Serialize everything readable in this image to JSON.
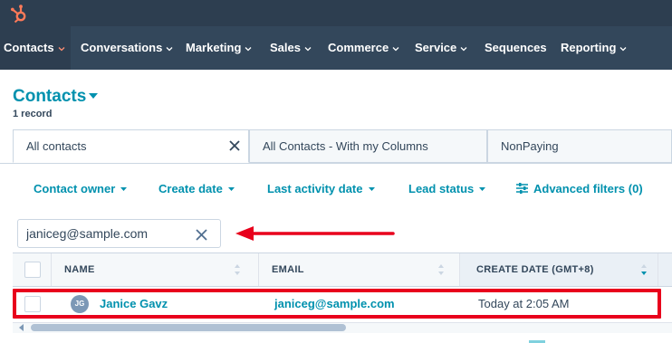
{
  "brand": {
    "logo_icon": "hubspot-sprocket-icon",
    "color": "#ff7a59"
  },
  "nav": {
    "items": [
      {
        "label": "Contacts",
        "has_menu": true,
        "active": true
      },
      {
        "label": "Conversations",
        "has_menu": true
      },
      {
        "label": "Marketing",
        "has_menu": true
      },
      {
        "label": "Sales",
        "has_menu": true
      },
      {
        "label": "Commerce",
        "has_menu": true
      },
      {
        "label": "Service",
        "has_menu": true
      },
      {
        "label": "Sequences",
        "has_menu": false
      },
      {
        "label": "Reporting",
        "has_menu": true
      }
    ]
  },
  "page": {
    "title": "Contacts",
    "record_count": "1 record"
  },
  "tabs": [
    {
      "label": "All contacts",
      "active": true,
      "closable": true
    },
    {
      "label": "All Contacts - With my Columns"
    },
    {
      "label": "NonPaying"
    }
  ],
  "filters": {
    "contact_owner": "Contact owner",
    "create_date": "Create date",
    "last_activity_date": "Last activity date",
    "lead_status": "Lead status",
    "advanced": "Advanced filters (0)"
  },
  "search": {
    "value": "janiceg@sample.com",
    "placeholder": ""
  },
  "table": {
    "columns": [
      "NAME",
      "EMAIL",
      "CREATE DATE (GMT+8)"
    ],
    "sorted_column": "CREATE DATE (GMT+8)",
    "sort_direction": "descending",
    "rows": [
      {
        "initials": "JG",
        "name": "Janice Gavz",
        "email": "janiceg@sample.com",
        "create_date": "Today at 2:05 AM"
      }
    ]
  },
  "colors": {
    "top_bar": "#2d3e50",
    "nav_bar": "#33475b",
    "link": "#0091ae",
    "annotation_red": "#e8001c",
    "text": "#33475b",
    "border": "#cbd6e2"
  }
}
